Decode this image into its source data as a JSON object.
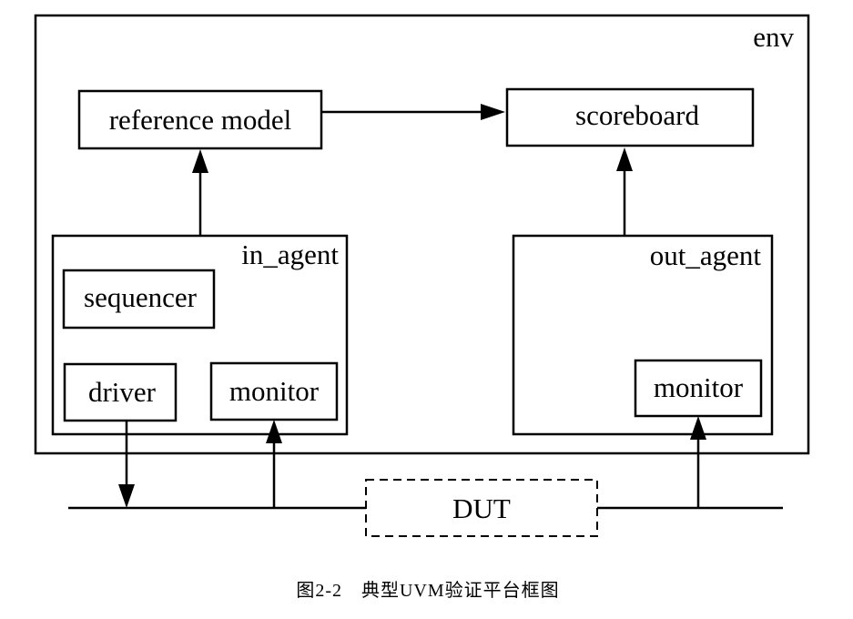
{
  "env": {
    "label": "env"
  },
  "reference_model": {
    "label": "reference model"
  },
  "scoreboard": {
    "label": "scoreboard"
  },
  "in_agent": {
    "label": "in_agent",
    "sequencer": "sequencer",
    "driver": "driver",
    "monitor": "monitor"
  },
  "out_agent": {
    "label": "out_agent",
    "monitor": "monitor"
  },
  "dut": {
    "label": "DUT"
  },
  "caption": "图2-2　典型UVM验证平台框图"
}
